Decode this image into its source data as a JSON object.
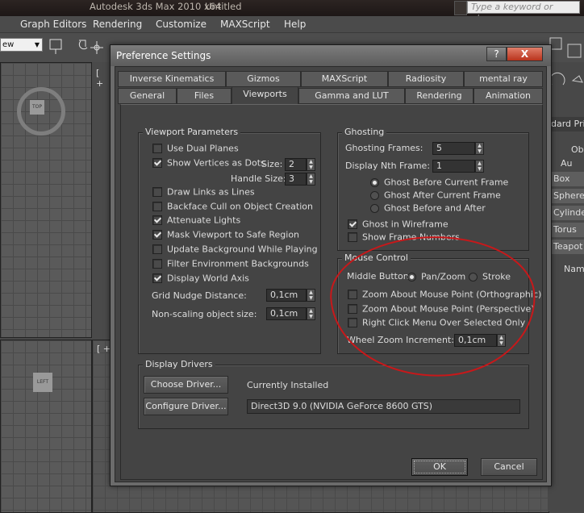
{
  "app": {
    "title_parts": [
      "Autodesk 3ds Max  2010 x64",
      "Untitled"
    ],
    "search_placeholder": "Type a keyword or phrase",
    "menu": [
      "Graph Editors",
      "Rendering",
      "Customize",
      "MAXScript",
      "Help"
    ],
    "view_select": "ew",
    "viewport_labels": [
      "[ +",
      "[ +"
    ],
    "gizmo_labels": [
      "TOP",
      "LEFT"
    ],
    "command_panel": [
      "Ob",
      "Au",
      "Box",
      "Sphere",
      "Cylinder",
      "Torus",
      "Teapot",
      "Name",
      "dard Prin"
    ]
  },
  "dialog": {
    "title": "Preference Settings",
    "help_label": "?",
    "close_label": "X",
    "tabs_row1": [
      "Inverse Kinematics",
      "Gizmos",
      "MAXScript",
      "Radiosity",
      "mental ray"
    ],
    "tabs_row2": [
      "General",
      "Files",
      "Viewports",
      "Gamma and LUT",
      "Rendering",
      "Animation"
    ],
    "active_tab": "Viewports",
    "viewport_params": {
      "title": "Viewport Parameters",
      "items": [
        {
          "label": "Use Dual Planes",
          "checked": false
        },
        {
          "label": "Show Vertices as Dots",
          "checked": true
        },
        {
          "label": "Draw Links as Lines",
          "checked": false
        },
        {
          "label": "Backface Cull on Object Creation",
          "checked": false
        },
        {
          "label": "Attenuate Lights",
          "checked": true
        },
        {
          "label": "Mask Viewport to Safe Region",
          "checked": true
        },
        {
          "label": "Update Background While Playing",
          "checked": false
        },
        {
          "label": "Filter Environment Backgrounds",
          "checked": false
        },
        {
          "label": "Display World Axis",
          "checked": true
        }
      ],
      "size_label": "Size:",
      "size_value": "2",
      "handle_size_label": "Handle Size:",
      "handle_size_value": "3",
      "grid_nudge_label": "Grid Nudge Distance:",
      "grid_nudge_value": "0,1cm",
      "non_scaling_label": "Non-scaling object size:",
      "non_scaling_value": "0,1cm"
    },
    "ghosting": {
      "title": "Ghosting",
      "frames_label": "Ghosting Frames:",
      "frames_value": "5",
      "nth_label": "Display Nth Frame:",
      "nth_value": "1",
      "radios": [
        {
          "label": "Ghost Before Current Frame",
          "selected": true
        },
        {
          "label": "Ghost After Current Frame",
          "selected": false
        },
        {
          "label": "Ghost Before and After",
          "selected": false
        }
      ],
      "checks": [
        {
          "label": "Ghost in Wireframe",
          "checked": true
        },
        {
          "label": "Show Frame Numbers",
          "checked": false
        }
      ]
    },
    "mouse_control": {
      "title": "Mouse Control",
      "middle_button_label": "Middle Button:",
      "middle_options": [
        {
          "label": "Pan/Zoom",
          "selected": true
        },
        {
          "label": "Stroke",
          "selected": false
        }
      ],
      "checks": [
        {
          "label": "Zoom About Mouse Point (Orthographic)",
          "checked": false
        },
        {
          "label": "Zoom About Mouse Point (Perspective)",
          "checked": false
        },
        {
          "label": "Right Click Menu Over Selected Only",
          "checked": false
        }
      ],
      "wheel_label": "Wheel Zoom Increment:",
      "wheel_value": "0,1cm"
    },
    "display_drivers": {
      "title": "Display Drivers",
      "choose_label": "Choose Driver...",
      "configure_label": "Configure Driver...",
      "installed_label": "Currently Installed",
      "installed_value": "Direct3D 9.0 (NVIDIA GeForce 8600 GTS)"
    },
    "ok_label": "OK",
    "cancel_label": "Cancel"
  },
  "colors": {
    "annotation": "#c8181a",
    "dialog_bg": "#444444",
    "close_button": "#b9331c"
  }
}
